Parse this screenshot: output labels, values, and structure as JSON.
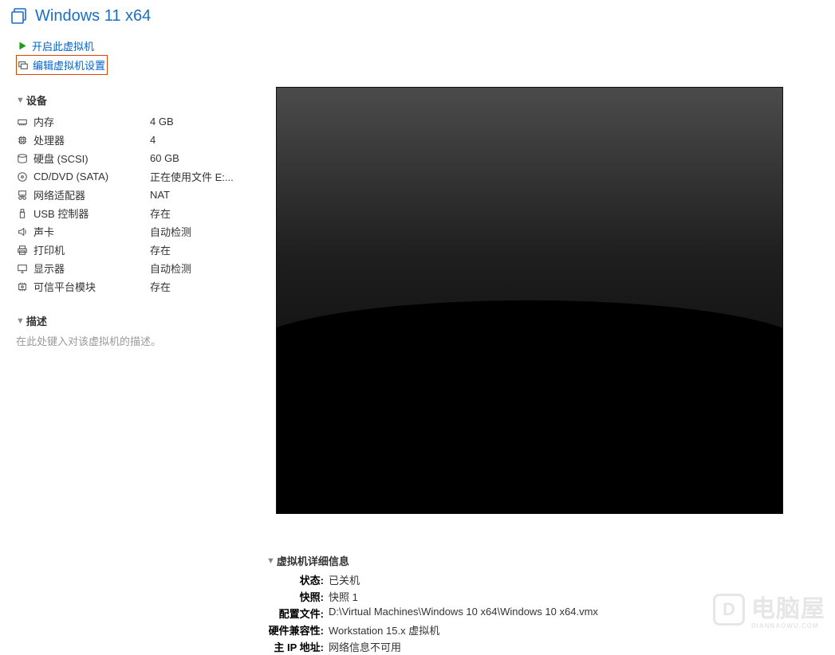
{
  "title": "Windows 11 x64",
  "actions": {
    "power_on": "开启此虚拟机",
    "edit_settings": "编辑虚拟机设置"
  },
  "sections": {
    "devices_title": "设备",
    "description_title": "描述",
    "description_placeholder": "在此处键入对该虚拟机的描述。"
  },
  "devices": [
    {
      "icon": "memory-icon",
      "name": "内存",
      "value": "4 GB"
    },
    {
      "icon": "cpu-icon",
      "name": "处理器",
      "value": "4"
    },
    {
      "icon": "disk-icon",
      "name": "硬盘 (SCSI)",
      "value": "60 GB"
    },
    {
      "icon": "disc-icon",
      "name": "CD/DVD (SATA)",
      "value": "正在使用文件 E:..."
    },
    {
      "icon": "network-icon",
      "name": "网络适配器",
      "value": "NAT"
    },
    {
      "icon": "usb-icon",
      "name": "USB 控制器",
      "value": "存在"
    },
    {
      "icon": "sound-icon",
      "name": "声卡",
      "value": "自动检测"
    },
    {
      "icon": "printer-icon",
      "name": "打印机",
      "value": "存在"
    },
    {
      "icon": "display-icon",
      "name": "显示器",
      "value": "自动检测"
    },
    {
      "icon": "tpm-icon",
      "name": "可信平台模块",
      "value": "存在"
    }
  ],
  "details": {
    "title": "虚拟机详细信息",
    "rows": [
      {
        "label": "状态:",
        "value": "已关机"
      },
      {
        "label": "快照:",
        "value": "快照 1"
      },
      {
        "label": "配置文件:",
        "value": "D:\\Virtual Machines\\Windows 10 x64\\Windows 10 x64.vmx"
      },
      {
        "label": "硬件兼容性:",
        "value": "Workstation 15.x 虚拟机"
      },
      {
        "label": "主 IP 地址:",
        "value": "网络信息不可用"
      }
    ]
  },
  "watermark": {
    "main": "电脑屋",
    "sub": "DIANNAOWU.COM",
    "icon": "D"
  }
}
